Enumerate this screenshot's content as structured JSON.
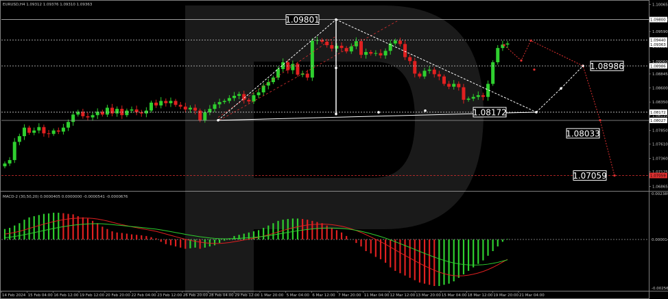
{
  "header": {
    "symbol_line": "EURUSD,H4  1.09312 1.09376 1.09310 1.09363",
    "macd_line": "MACD-2 (30,50,20) 0.0000405 0.0000000 -0.0000541 -0.0000676"
  },
  "colors": {
    "background": "#000000",
    "bull": "#2fd02f",
    "bear": "#e02020",
    "text": "#c8c8c8",
    "forecast_white": "#ffffff",
    "forecast_red": "#e03030",
    "macd_signal_red": "#e02020",
    "macd_signal_green": "#2fd02f"
  },
  "chart_data": {
    "type": "candlestick",
    "symbol": "EURUSD",
    "timeframe": "H4",
    "x_ticks": [
      "14 Feb 2024",
      "15 Feb 04:00",
      "16 Feb 12:00",
      "19 Feb 12:00",
      "20 Feb 20:00",
      "22 Feb 04:00",
      "23 Feb 12:00",
      "26 Feb 20:00",
      "28 Feb 04:00",
      "29 Feb 12:00",
      "1 Mar 20:00",
      "5 Mar 04:00",
      "6 Mar 12:00",
      "7 Mar 20:00",
      "11 Mar 04:00",
      "12 Mar 12:00",
      "13 Mar 20:00",
      "15 Mar 04:00",
      "18 Mar 12:00",
      "19 Mar 20:00",
      "21 Mar 04:00"
    ],
    "y_ticks": [
      "1.10065",
      "1.09800",
      "1.09590",
      "1.09325",
      "1.09060",
      "1.08845",
      "1.08600",
      "1.08350",
      "1.08110",
      "1.07850",
      "1.07610",
      "1.07360",
      "1.07125",
      "1.06865"
    ],
    "price_labels": [
      "1.09800",
      "1.09440",
      "1.09363",
      "1.08986",
      "1.08172",
      "1.08027",
      "1.07059"
    ],
    "annotations": [
      "1.09801",
      "1.08986",
      "1.08172",
      "1.08033",
      "1.07059"
    ],
    "closes": [
      1.0727,
      1.0733,
      1.0765,
      1.0775,
      1.079,
      1.0781,
      1.0785,
      1.0791,
      1.078,
      1.0779,
      1.0785,
      1.0783,
      1.079,
      1.08,
      1.0813,
      1.0818,
      1.081,
      1.0808,
      1.0812,
      1.0818,
      1.0813,
      1.0825,
      1.0815,
      1.0823,
      1.0812,
      1.082,
      1.0822,
      1.0817,
      1.0815,
      1.082,
      1.0834,
      1.0829,
      1.0837,
      1.0833,
      1.0837,
      1.083,
      1.0827,
      1.0822,
      1.0825,
      1.082,
      1.0803,
      1.0817,
      1.0823,
      1.0831,
      1.0835,
      1.0837,
      1.0842,
      1.0846,
      1.0849,
      1.0839,
      1.0836,
      1.0847,
      1.0852,
      1.0864,
      1.087,
      1.0878,
      1.0893,
      1.0905,
      1.0891,
      1.0902,
      1.0883,
      1.0885,
      1.0878,
      1.0943,
      1.0944,
      1.0941,
      1.0935,
      1.0929,
      1.0934,
      1.093,
      1.0924,
      1.0933,
      1.0942,
      1.0918,
      1.0923,
      1.092,
      1.0921,
      1.0917,
      1.0925,
      1.0938,
      1.0943,
      1.0937,
      1.0914,
      1.0907,
      1.0885,
      1.088,
      1.089,
      1.0892,
      1.0884,
      1.088,
      1.0867,
      1.0862,
      1.0867,
      1.0861,
      1.0839,
      1.0841,
      1.0844,
      1.0847,
      1.0844,
      1.0867,
      1.0905,
      1.093,
      1.0936,
      1.0938
    ],
    "macd_hist": [
      0.45,
      0.5,
      0.6,
      0.7,
      0.85,
      0.95,
      1.0,
      1.05,
      1.1,
      1.12,
      1.15,
      1.15,
      1.13,
      1.1,
      1.08,
      1.0,
      0.95,
      0.9,
      0.8,
      0.7,
      0.55,
      0.45,
      0.35,
      0.3,
      0.28,
      0.25,
      0.22,
      0.2,
      0.18,
      0.15,
      0.1,
      0.05,
      -0.1,
      -0.2,
      -0.25,
      -0.3,
      -0.35,
      -0.4,
      -0.38,
      -0.35,
      -0.4,
      -0.35,
      -0.3,
      -0.25,
      -0.15,
      -0.05,
      0.05,
      0.15,
      0.2,
      0.25,
      0.3,
      0.35,
      0.4,
      0.5,
      0.6,
      0.7,
      0.8,
      0.85,
      0.88,
      0.9,
      0.9,
      0.88,
      0.85,
      0.8,
      0.75,
      0.7,
      0.6,
      0.5,
      0.4,
      0.3,
      0.15,
      0.0,
      -0.15,
      -0.3,
      -0.5,
      -0.6,
      -0.75,
      -0.85,
      -1.0,
      -1.2,
      -1.35,
      -1.45,
      -1.55,
      -1.65,
      -1.75,
      -1.85,
      -1.9,
      -1.95,
      -2.0,
      -2.0,
      -1.95,
      -1.9,
      -1.8,
      -1.65,
      -1.5,
      -1.35,
      -1.2,
      -1.05,
      -0.9,
      -0.7,
      -0.5,
      -0.3,
      -0.1,
      0.02
    ],
    "ylim": [
      1.068,
      1.1012
    ]
  }
}
